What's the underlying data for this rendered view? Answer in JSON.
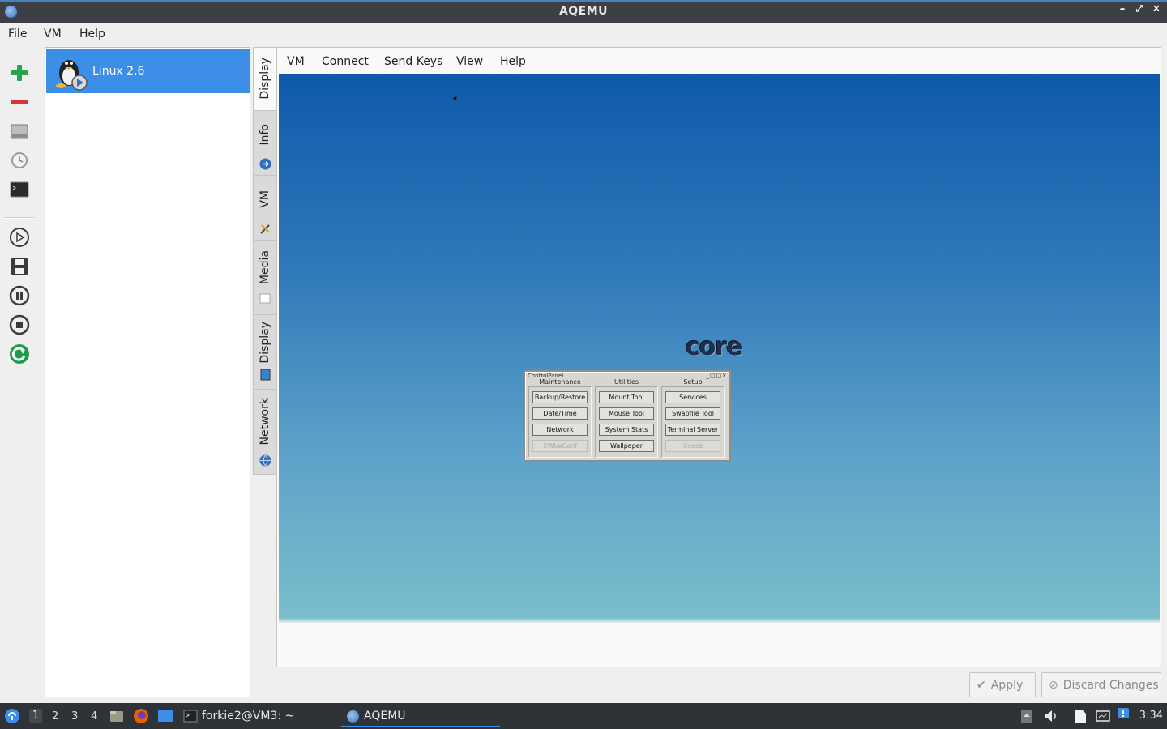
{
  "window": {
    "title": "AQEMU"
  },
  "menubar": {
    "items": [
      "File",
      "VM",
      "Help"
    ]
  },
  "left_toolbar": {
    "icons": [
      "add-vm-icon",
      "remove-vm-icon",
      "hard-disk-icon",
      "snapshot-clock-icon",
      "terminal-icon",
      "play-icon",
      "save-icon",
      "pause-icon",
      "stop-icon",
      "reset-icon"
    ]
  },
  "vm_list": {
    "items": [
      {
        "name": "Linux 2.6",
        "selected": true
      }
    ]
  },
  "tabs": {
    "items": [
      "Display",
      "Info",
      "VM",
      "Media",
      "Display",
      "Network"
    ],
    "active": "Display"
  },
  "panel_menu": {
    "items": [
      "VM",
      "Connect",
      "Send Keys",
      "View",
      "Help"
    ]
  },
  "guest": {
    "logo_text": "core",
    "control_panel": {
      "title": "ControlPanel",
      "window_buttons": "_□□X",
      "columns": [
        {
          "header": "Maintenance",
          "buttons": [
            "Backup/Restore",
            "Date/Time",
            "Network",
            "XWbeConf"
          ],
          "disabled_last": true
        },
        {
          "header": "Utilities",
          "buttons": [
            "Mount Tool",
            "Mouse Tool",
            "System Stats",
            "Wallpaper"
          ],
          "disabled_last": false
        },
        {
          "header": "Setup",
          "buttons": [
            "Services",
            "Swapfile Tool",
            "Terminal Server",
            "Xvesa"
          ],
          "disabled_last": true
        }
      ]
    }
  },
  "actions": {
    "apply": "Apply",
    "discard": "Discard Changes"
  },
  "taskbar": {
    "workspaces": [
      "1",
      "2",
      "3",
      "4"
    ],
    "active_workspace": "1",
    "tasks": [
      {
        "label": "forkie2@VM3: ~",
        "active": false
      },
      {
        "label": "AQEMU",
        "active": true
      }
    ],
    "clock": "3:34"
  },
  "colors": {
    "selection": "#3d8ee6",
    "titlebar": "#3c3f44",
    "taskbar": "#2f3338"
  }
}
